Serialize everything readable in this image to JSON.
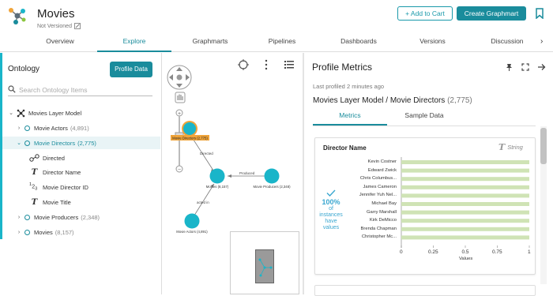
{
  "app": {
    "title": "Movies",
    "subtitle": "Not Versioned"
  },
  "actions": {
    "add_to_cart": "+ Add to Cart",
    "create_graphmart": "Create Graphmart"
  },
  "tabs": [
    "Overview",
    "Explore",
    "Graphmarts",
    "Pipelines",
    "Dashboards",
    "Versions",
    "Discussion"
  ],
  "active_tab": "Explore",
  "ontology": {
    "title": "Ontology",
    "profile_button": "Profile Data",
    "search_placeholder": "Search Ontology Items",
    "model": "Movies Layer Model",
    "items": [
      {
        "label": "Movie Actors",
        "count": "(4,891)"
      },
      {
        "label": "Movie Directors",
        "count": "(2,775)"
      },
      {
        "label": "Directed"
      },
      {
        "label": "Director Name"
      },
      {
        "label": "Movie Director ID"
      },
      {
        "label": "Movie Title"
      },
      {
        "label": "Movie Producers",
        "count": "(2,348)"
      },
      {
        "label": "Movies",
        "count": "(8,157)"
      }
    ]
  },
  "graph": {
    "nodes": [
      {
        "label": "Movie Directors (2,775)"
      },
      {
        "label": "Movies (8,157)"
      },
      {
        "label": "Movie Producers (2,348)"
      },
      {
        "label": "Movie Actors (4,891)"
      }
    ],
    "edges": [
      "Directed",
      "Produced",
      "acted in"
    ],
    "colors": {
      "node": "#1ab5c9",
      "highlight": "#f0a43a"
    }
  },
  "profile": {
    "title": "Profile Metrics",
    "last_profiled": "Last profiled 2 minutes ago",
    "path": "Movies Layer Model / Movie Directors",
    "path_count": "(2,775)",
    "tabs": [
      "Metrics",
      "Sample Data"
    ],
    "active_tab": "Metrics",
    "card_title": "Director Name",
    "card_type": "String",
    "percent": "100%",
    "percent_text": "of instances have values"
  },
  "chart_data": {
    "type": "bar",
    "orientation": "horizontal",
    "categories": [
      "Kevin Costner",
      "Edward Zwick",
      "Chris Columbus...",
      "James Cameron",
      "Jennifer Yuh Nel...",
      "Michael Bay",
      "Garry Marshall",
      "Kirk DeMicco",
      "Brenda Chapman",
      "Christopher Mc..."
    ],
    "values": [
      1,
      1,
      1,
      1,
      1,
      1,
      1,
      1,
      1,
      1
    ],
    "xlabel": "Values",
    "xlim": [
      0,
      1
    ],
    "xticks": [
      "0",
      "0.25",
      "0.5",
      "0.75",
      "1"
    ],
    "bar_color": "#cfe3b5"
  }
}
